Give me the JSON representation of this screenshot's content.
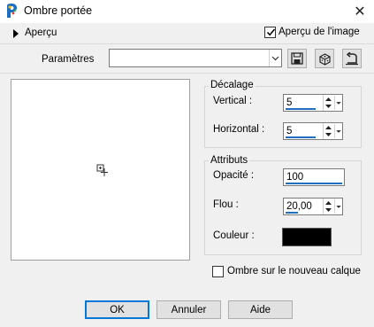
{
  "window": {
    "title": "Ombre portée",
    "close_glyph": "✕",
    "icon": "psp-app-icon"
  },
  "preview_toggle": {
    "label": "Aperçu",
    "show_image_label": "Aperçu de l'image",
    "show_image_checked": true
  },
  "params": {
    "label": "Paramètres",
    "value": "",
    "tools": [
      "save-preset-icon",
      "randomize-dice-icon",
      "reset-icon"
    ]
  },
  "offset_group": {
    "title": "Décalage",
    "vertical": {
      "label": "Vertical :",
      "value": "5"
    },
    "horizontal": {
      "label": "Horizontal :",
      "value": "5"
    }
  },
  "attributes_group": {
    "title": "Attributs",
    "opacity": {
      "label": "Opacité :",
      "value": "100"
    },
    "blur": {
      "label": "Flou :",
      "value": "20,00"
    },
    "color": {
      "label": "Couleur :",
      "value": "#000000"
    }
  },
  "new_layer": {
    "label": "Ombre sur le nouveau calque",
    "checked": false
  },
  "buttons": {
    "ok": "OK",
    "cancel": "Annuler",
    "help": "Aide"
  },
  "colors": {
    "accent": "#0078d7",
    "slider_bar": "#1e6fc0",
    "background": "#f0f0f0"
  }
}
